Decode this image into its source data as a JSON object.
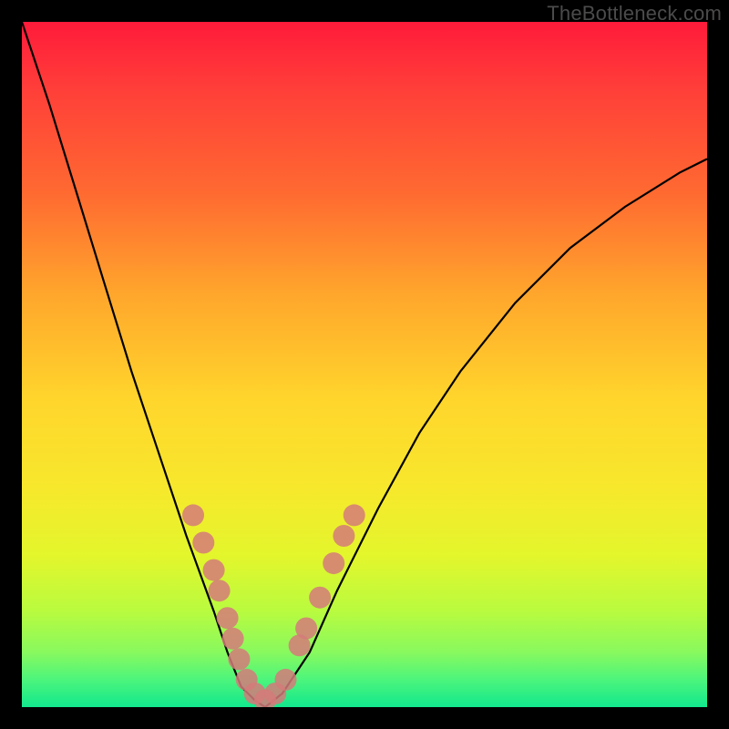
{
  "watermark": "TheBottleneck.com",
  "chart_data": {
    "type": "line",
    "title": "",
    "xlabel": "",
    "ylabel": "",
    "xlim": [
      0,
      100
    ],
    "ylim": [
      0,
      100
    ],
    "series": [
      {
        "name": "bottleneck-curve",
        "x": [
          0,
          4,
          8,
          12,
          16,
          20,
          24,
          28,
          30,
          32,
          34,
          35.5,
          38,
          42,
          46,
          52,
          58,
          64,
          72,
          80,
          88,
          96,
          100
        ],
        "values": [
          100,
          88,
          75,
          62,
          49,
          37,
          25,
          14,
          8,
          3,
          1,
          0,
          2,
          8,
          17,
          29,
          40,
          49,
          59,
          67,
          73,
          78,
          80
        ]
      }
    ],
    "markers": {
      "name": "sample-points",
      "color": "#d57a7a",
      "radius": 12,
      "points": [
        {
          "x": 25.0,
          "y": 28.0
        },
        {
          "x": 26.5,
          "y": 24.0
        },
        {
          "x": 28.0,
          "y": 20.0
        },
        {
          "x": 28.8,
          "y": 17.0
        },
        {
          "x": 30.0,
          "y": 13.0
        },
        {
          "x": 30.8,
          "y": 10.0
        },
        {
          "x": 31.7,
          "y": 7.0
        },
        {
          "x": 32.8,
          "y": 4.0
        },
        {
          "x": 34.0,
          "y": 2.0
        },
        {
          "x": 35.5,
          "y": 1.0
        },
        {
          "x": 37.0,
          "y": 2.0
        },
        {
          "x": 38.5,
          "y": 4.0
        },
        {
          "x": 40.5,
          "y": 9.0
        },
        {
          "x": 41.5,
          "y": 11.5
        },
        {
          "x": 43.5,
          "y": 16.0
        },
        {
          "x": 45.5,
          "y": 21.0
        },
        {
          "x": 47.0,
          "y": 25.0
        },
        {
          "x": 48.5,
          "y": 28.0
        }
      ]
    }
  }
}
